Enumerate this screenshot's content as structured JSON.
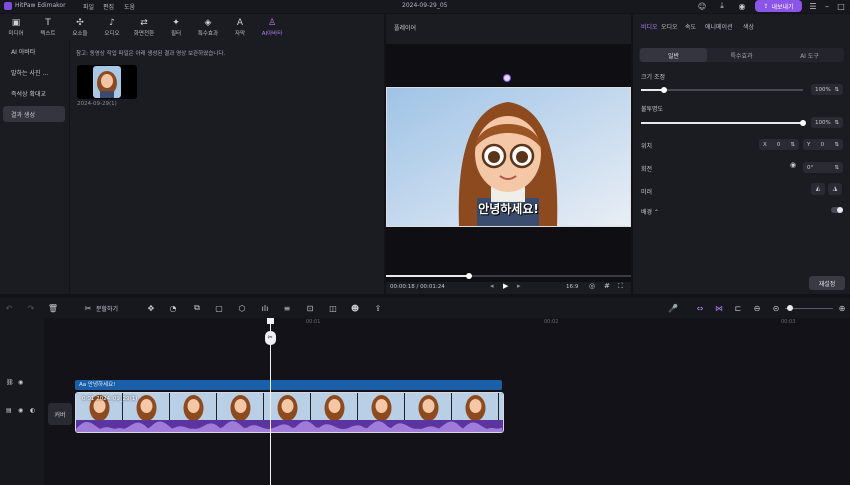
{
  "app": {
    "title": "HitPaw Edimakor",
    "menu": [
      "파일",
      "편집",
      "도움"
    ],
    "project_name": "2024-09-29_05",
    "export_label": "내보내기"
  },
  "toolbar": {
    "tools": [
      {
        "label": "미디어",
        "icon": "media-icon"
      },
      {
        "label": "텍스트",
        "icon": "text-icon"
      },
      {
        "label": "요소들",
        "icon": "elements-icon"
      },
      {
        "label": "오디오",
        "icon": "audio-icon"
      },
      {
        "label": "화면전환",
        "icon": "transition-icon"
      },
      {
        "label": "필터",
        "icon": "filter-icon"
      },
      {
        "label": "특수효과",
        "icon": "effects-icon"
      },
      {
        "label": "자막",
        "icon": "subtitle-icon"
      },
      {
        "label": "AI아바타",
        "icon": "ai-avatar-icon",
        "active": true
      }
    ]
  },
  "left_nav": {
    "items": [
      "AI 아바타",
      "말하는 사진 ...",
      "즉석상 확대교",
      "결과 생성"
    ],
    "active_index": 3
  },
  "media": {
    "notice": "참고: 동영상 작업 파일은 아래 생성된 결과 영상 보관하였습니다.",
    "item_date": "2024-09-29(1)"
  },
  "preview": {
    "title": "플레이어",
    "caption": "안녕하세요!",
    "time_current": "00:00:18",
    "time_total": "00:01:24",
    "ratio": "16:9",
    "progress": 0.34
  },
  "props": {
    "tabs": [
      "비디오",
      "오디오",
      "속도",
      "애니메이션",
      "색상"
    ],
    "active_tab": 0,
    "segments": [
      "일반",
      "특수효과",
      "AI 도구"
    ],
    "active_segment": 0,
    "scale_label": "크기 조정",
    "scale_value": "100%",
    "scale_level": 0.14,
    "opacity_label": "불투명도",
    "opacity_value": "100%",
    "opacity_level": 1.0,
    "position_label": "위치",
    "pos_x_label": "X",
    "pos_x": "0",
    "pos_y_label": "Y",
    "pos_y": "0",
    "rotate_label": "회전",
    "rotate_value": "0°",
    "mirror_label": "미러",
    "blend_label": "배경",
    "reset_label": "재설정"
  },
  "timeline": {
    "split_label": "분할하기",
    "ruler": [
      "00:01",
      "00:02",
      "00:03"
    ],
    "text_clip_label": "Aa  안녕하세요!",
    "video_clip_label": "0:01  2024_09_29(1)",
    "cover_label": "커버",
    "playhead_time_fraction": 0.28
  },
  "colors": {
    "accent": "#8b55e9",
    "text_clip": "#1b5fa8",
    "audio_wave": "#6c3fb0"
  }
}
